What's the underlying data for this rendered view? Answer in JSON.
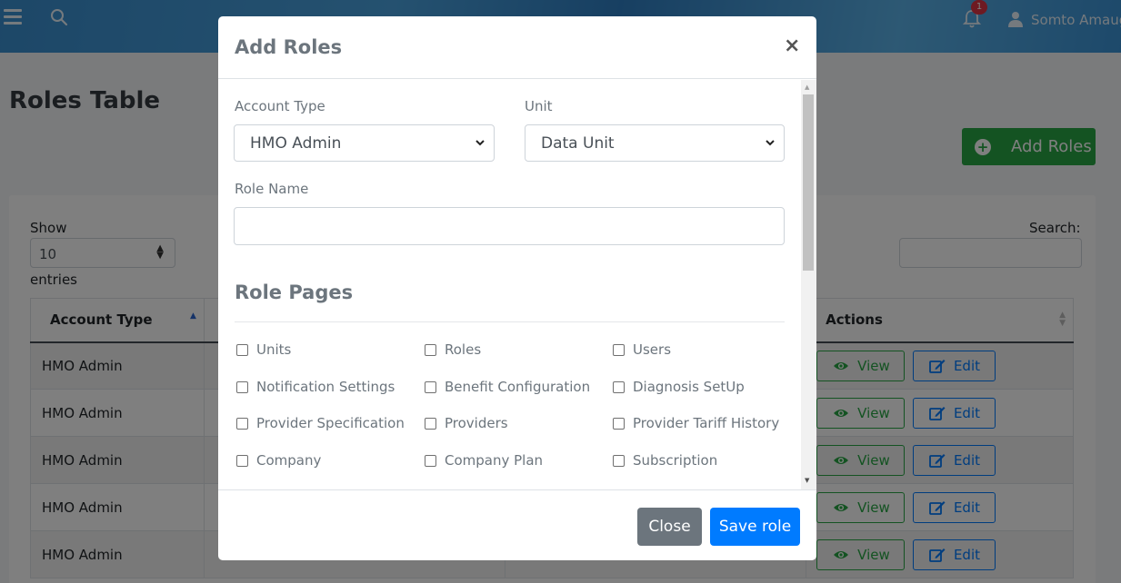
{
  "header": {
    "notification_count": "1",
    "user_name": "Somto Amaugo"
  },
  "page": {
    "title": "Roles Table",
    "add_button_label": "Add Roles"
  },
  "table_controls": {
    "show_label": "Show",
    "entries_value": "10",
    "entries_label": "entries",
    "search_label": "Search:"
  },
  "table": {
    "headers": [
      "Account Type",
      "",
      "",
      "Actions"
    ],
    "rows": [
      {
        "account_type": "HMO Admin"
      },
      {
        "account_type": "HMO Admin"
      },
      {
        "account_type": "HMO Admin"
      },
      {
        "account_type": "HMO Admin"
      },
      {
        "account_type": "HMO Admin"
      }
    ],
    "view_label": "View",
    "edit_label": "Edit"
  },
  "modal": {
    "title": "Add Roles",
    "close_symbol": "×",
    "account_type_label": "Account Type",
    "account_type_value": "HMO Admin",
    "unit_label": "Unit",
    "unit_value": "Data Unit",
    "role_name_label": "Role Name",
    "role_name_value": "",
    "section_title": "Role Pages",
    "pages": [
      "Units",
      "Roles",
      "Users",
      "Notification Settings",
      "Benefit Configuration",
      "Diagnosis SetUp",
      "Provider Specification",
      "Providers",
      "Provider Tariff History",
      "Company",
      "Company Plan",
      "Subscription"
    ],
    "close_label": "Close",
    "save_label": "Save role"
  },
  "colors": {
    "primary": "#007bff",
    "success": "#28a745",
    "secondary": "#6c757d",
    "danger": "#dc3545"
  }
}
